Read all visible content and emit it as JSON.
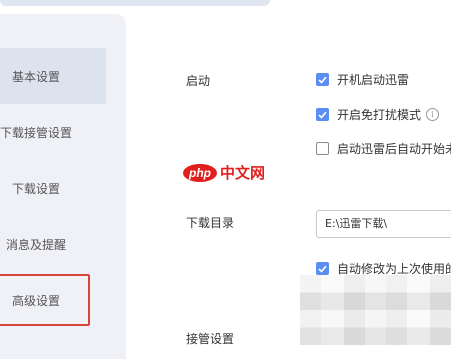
{
  "sidebar": {
    "items": [
      {
        "label": "基本设置",
        "active": true
      },
      {
        "label": "下载接管设置",
        "active": false
      },
      {
        "label": "下载设置",
        "active": false
      },
      {
        "label": "消息及提醒",
        "active": false
      },
      {
        "label": "高级设置",
        "active": false,
        "highlighted": true
      }
    ]
  },
  "main": {
    "startup": {
      "label": "启动",
      "options": [
        {
          "label": "开机启动迅雷",
          "checked": true
        },
        {
          "label": "开启免打扰模式",
          "checked": true,
          "icon": "info-icon"
        },
        {
          "label": "启动迅雷后自动开始未",
          "checked": false
        }
      ]
    },
    "download_dir": {
      "label": "下载目录",
      "path": "E:\\迅雷下载\\",
      "auto_modify_label": "自动修改为上次使用的",
      "auto_modify_checked": true
    },
    "takeover": {
      "label": "接管设置"
    }
  },
  "watermark": {
    "php": "php",
    "cn": "中文网"
  },
  "colors": {
    "accent": "#5b8ef0",
    "highlight_border": "#d9443a",
    "sidebar_bg": "#f0f1f6",
    "sidebar_active": "#dde2ef"
  }
}
